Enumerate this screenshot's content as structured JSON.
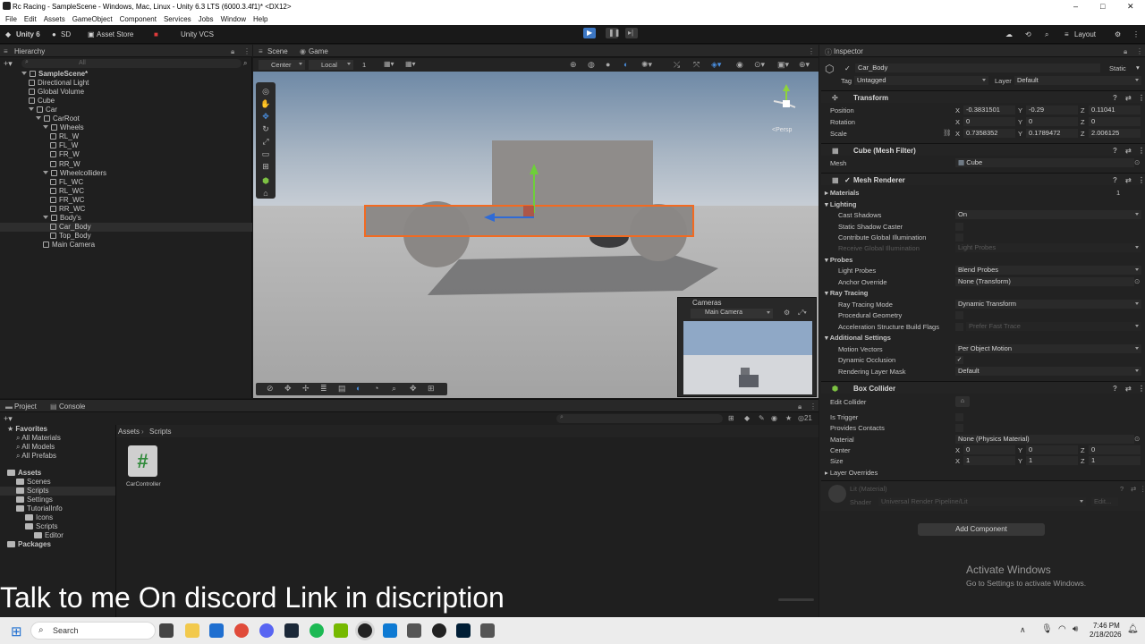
{
  "window": {
    "title": "Rc Racing - SampleScene - Windows, Mac, Linux - Unity 6.3 LTS (6000.3.4f1)* <DX12>",
    "minimize": "–",
    "maximize": "□",
    "close": "✕"
  },
  "menu": [
    "File",
    "Edit",
    "Assets",
    "GameObject",
    "Component",
    "Services",
    "Jobs",
    "Window",
    "Help"
  ],
  "toolbar": {
    "unity": "Unity 6",
    "account": "SD",
    "asset_store": "Asset Store",
    "vcs": "Unity VCS",
    "layout": "Layout"
  },
  "hierarchy": {
    "tab": "Hierarchy",
    "search_placeholder": "All",
    "items": [
      {
        "label": "SampleScene*",
        "depth": 0,
        "bold": true
      },
      {
        "label": "Directional Light",
        "depth": 1
      },
      {
        "label": "Global Volume",
        "depth": 1
      },
      {
        "label": "Cube",
        "depth": 1
      },
      {
        "label": "Car",
        "depth": 1
      },
      {
        "label": "CarRoot",
        "depth": 2
      },
      {
        "label": "Wheels",
        "depth": 3
      },
      {
        "label": "RL_W",
        "depth": 4
      },
      {
        "label": "FL_W",
        "depth": 4
      },
      {
        "label": "FR_W",
        "depth": 4
      },
      {
        "label": "RR_W",
        "depth": 4
      },
      {
        "label": "Wheelcolliders",
        "depth": 3
      },
      {
        "label": "FL_WC",
        "depth": 4
      },
      {
        "label": "RL_WC",
        "depth": 4
      },
      {
        "label": "FR_WC",
        "depth": 4
      },
      {
        "label": "RR_WC",
        "depth": 4
      },
      {
        "label": "Body's",
        "depth": 3
      },
      {
        "label": "Car_Body",
        "depth": 4,
        "selected": true
      },
      {
        "label": "Top_Body",
        "depth": 4
      },
      {
        "label": "Main Camera",
        "depth": 3
      }
    ]
  },
  "scene": {
    "tabs": [
      "Scene",
      "Game"
    ],
    "pivot": "Center",
    "space": "Local",
    "snap": "1",
    "gizmo_label": "<Persp",
    "overlay": {
      "title": "Cameras",
      "camera": "Main Camera"
    }
  },
  "inspector": {
    "tab": "Inspector",
    "object_name": "Car_Body",
    "static_label": "Static",
    "tag_label": "Tag",
    "tag": "Untagged",
    "layer_label": "Layer",
    "layer": "Default",
    "transform": {
      "title": "Transform",
      "position_label": "Position",
      "rotation_label": "Rotation",
      "scale_label": "Scale",
      "position": {
        "x": "-0.3831501",
        "y": "-0.29",
        "z": "0.11041"
      },
      "rotation": {
        "x": "0",
        "y": "0",
        "z": "0"
      },
      "scale": {
        "x": "0.7358352",
        "y": "0.1789472",
        "z": "2.006125"
      }
    },
    "mesh_filter": {
      "title": "Cube (Mesh Filter)",
      "mesh_label": "Mesh",
      "mesh": "Cube"
    },
    "mesh_renderer": {
      "title": "Mesh Renderer",
      "materials_label": "Materials",
      "materials_count": "1",
      "lighting": "Lighting",
      "cast_shadows_label": "Cast Shadows",
      "cast_shadows": "On",
      "static_shadow_caster": "Static Shadow Caster",
      "contribute_gi": "Contribute Global Illumination",
      "receive_gi": "Receive Global Illumination",
      "receive_gi_value": "Light Probes",
      "probes": "Probes",
      "light_probes_label": "Light Probes",
      "light_probes": "Blend Probes",
      "anchor_override_label": "Anchor Override",
      "anchor_override": "None (Transform)",
      "ray_tracing": "Ray Tracing",
      "ray_tracing_mode_label": "Ray Tracing Mode",
      "ray_tracing_mode": "Dynamic Transform",
      "procedural_geometry": "Procedural Geometry",
      "accel_flags_label": "Acceleration Structure Build Flags",
      "accel_flags": "Prefer Fast Trace",
      "additional_settings": "Additional Settings",
      "motion_vectors_label": "Motion Vectors",
      "motion_vectors": "Per Object Motion",
      "dynamic_occlusion": "Dynamic Occlusion",
      "check_mark": "✓",
      "rendering_layer_mask_label": "Rendering Layer Mask",
      "rendering_layer_mask": "Default"
    },
    "box_collider": {
      "title": "Box Collider",
      "edit_collider": "Edit Collider",
      "is_trigger": "Is Trigger",
      "provides_contacts": "Provides Contacts",
      "material_label": "Material",
      "material": "None (Physics Material)",
      "center_label": "Center",
      "center": {
        "x": "0",
        "y": "0",
        "z": "0"
      },
      "size_label": "Size",
      "size": {
        "x": "1",
        "y": "1",
        "z": "1"
      },
      "layer_overrides": "Layer Overrides"
    },
    "material": {
      "name": "Lit (Material)",
      "shader_label": "Shader",
      "shader": "Universal Render Pipeline/Lit",
      "edit": "Edit..."
    },
    "axis_x": "X",
    "axis_y": "Y",
    "axis_z": "Z",
    "add_component": "Add Component"
  },
  "project": {
    "tabs": [
      "Project",
      "Console"
    ],
    "favorites": "Favorites",
    "favorite_items": [
      "All Materials",
      "All Models",
      "All Prefabs"
    ],
    "assets": "Assets",
    "asset_items": [
      {
        "label": "Scenes",
        "depth": 1
      },
      {
        "label": "Scripts",
        "depth": 1,
        "selected": true
      },
      {
        "label": "Settings",
        "depth": 1
      },
      {
        "label": "TutorialInfo",
        "depth": 1
      },
      {
        "label": "Icons",
        "depth": 2
      },
      {
        "label": "Scripts",
        "depth": 2
      },
      {
        "label": "Editor",
        "depth": 3
      }
    ],
    "packages": "Packages",
    "breadcrumb": [
      "Assets",
      "Scripts"
    ],
    "file_label": "CarController",
    "file_glyph": "#",
    "count": "21"
  },
  "activation": {
    "title": "Activate Windows",
    "sub": "Go to Settings to activate Windows."
  },
  "caption": "Talk to me On discord Link in discription",
  "taskbar": {
    "search": "Search",
    "time": "7:46 PM",
    "date": "2/18/2026"
  }
}
